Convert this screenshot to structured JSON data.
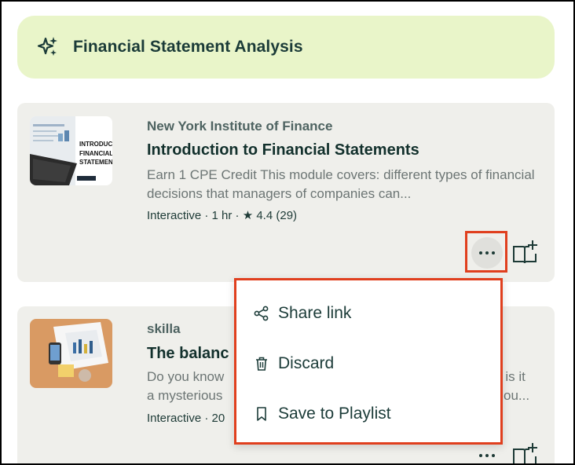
{
  "banner": {
    "title": "Financial Statement Analysis",
    "icon": "sparkle-icon"
  },
  "courses": [
    {
      "provider": "New York Institute of Finance",
      "title": "Introduction to Financial Statements",
      "description": "Earn 1 CPE Credit This module covers: different types of financial decisions that managers of companies can...",
      "meta_format": "Interactive · 1 hr · ",
      "rating": "4.4",
      "rating_count": "(29)",
      "thumbnail_lines": [
        "INTRODUCTION T",
        "FINANCIAL",
        "STATEMENTS"
      ]
    },
    {
      "provider": "skilla",
      "title": "The balanc",
      "description_line1": "Do you know",
      "description_line1_tail": "r is it",
      "description_line2": "a mysterious",
      "description_line2_tail": "ou...",
      "meta_format": "Interactive · 20"
    }
  ],
  "menu": {
    "items": [
      {
        "label": "Share link",
        "icon": "share-icon"
      },
      {
        "label": "Discard",
        "icon": "trash-icon"
      },
      {
        "label": "Save to Playlist",
        "icon": "bookmark-icon"
      }
    ]
  },
  "colors": {
    "accent_highlight": "#e03f1e",
    "banner_bg": "#e9f5c9",
    "card_bg": "#efefeb"
  }
}
